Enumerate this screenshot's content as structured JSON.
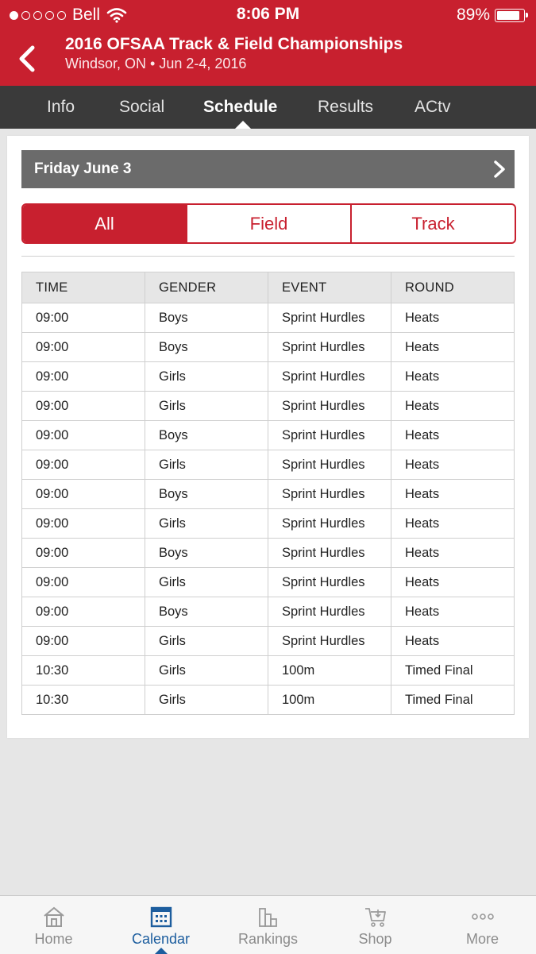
{
  "status_bar": {
    "carrier": "Bell",
    "time": "8:06 PM",
    "battery": "89%"
  },
  "header": {
    "title": "2016 OFSAA Track & Field Championships",
    "subtitle": "Windsor, ON • Jun 2-4, 2016"
  },
  "tabs": [
    {
      "label": "Info"
    },
    {
      "label": "Social"
    },
    {
      "label": "Schedule",
      "active": true
    },
    {
      "label": "Results"
    },
    {
      "label": "ACtv"
    }
  ],
  "schedule": {
    "day_label": "Friday June 3",
    "filters": [
      {
        "label": "All",
        "active": true
      },
      {
        "label": "Field"
      },
      {
        "label": "Track"
      }
    ],
    "columns": [
      "TIME",
      "GENDER",
      "EVENT",
      "ROUND"
    ],
    "rows": [
      [
        "09:00",
        "Boys",
        "Sprint Hurdles",
        "Heats"
      ],
      [
        "09:00",
        "Boys",
        "Sprint Hurdles",
        "Heats"
      ],
      [
        "09:00",
        "Girls",
        "Sprint Hurdles",
        "Heats"
      ],
      [
        "09:00",
        "Girls",
        "Sprint Hurdles",
        "Heats"
      ],
      [
        "09:00",
        "Boys",
        "Sprint Hurdles",
        "Heats"
      ],
      [
        "09:00",
        "Girls",
        "Sprint Hurdles",
        "Heats"
      ],
      [
        "09:00",
        "Boys",
        "Sprint Hurdles",
        "Heats"
      ],
      [
        "09:00",
        "Girls",
        "Sprint Hurdles",
        "Heats"
      ],
      [
        "09:00",
        "Boys",
        "Sprint Hurdles",
        "Heats"
      ],
      [
        "09:00",
        "Girls",
        "Sprint Hurdles",
        "Heats"
      ],
      [
        "09:00",
        "Boys",
        "Sprint Hurdles",
        "Heats"
      ],
      [
        "09:00",
        "Girls",
        "Sprint Hurdles",
        "Heats"
      ],
      [
        "10:30",
        "Girls",
        "100m",
        "Timed Final"
      ],
      [
        "10:30",
        "Girls",
        "100m",
        "Timed Final"
      ]
    ]
  },
  "bottom_nav": [
    {
      "label": "Home",
      "icon": "home-icon"
    },
    {
      "label": "Calendar",
      "icon": "calendar-icon",
      "active": true
    },
    {
      "label": "Rankings",
      "icon": "rankings-icon"
    },
    {
      "label": "Shop",
      "icon": "cart-icon"
    },
    {
      "label": "More",
      "icon": "more-icon"
    }
  ],
  "colors": {
    "brand_red": "#c8202f",
    "tab_bar": "#3a3a3a",
    "active_nav": "#1c5d9e"
  }
}
